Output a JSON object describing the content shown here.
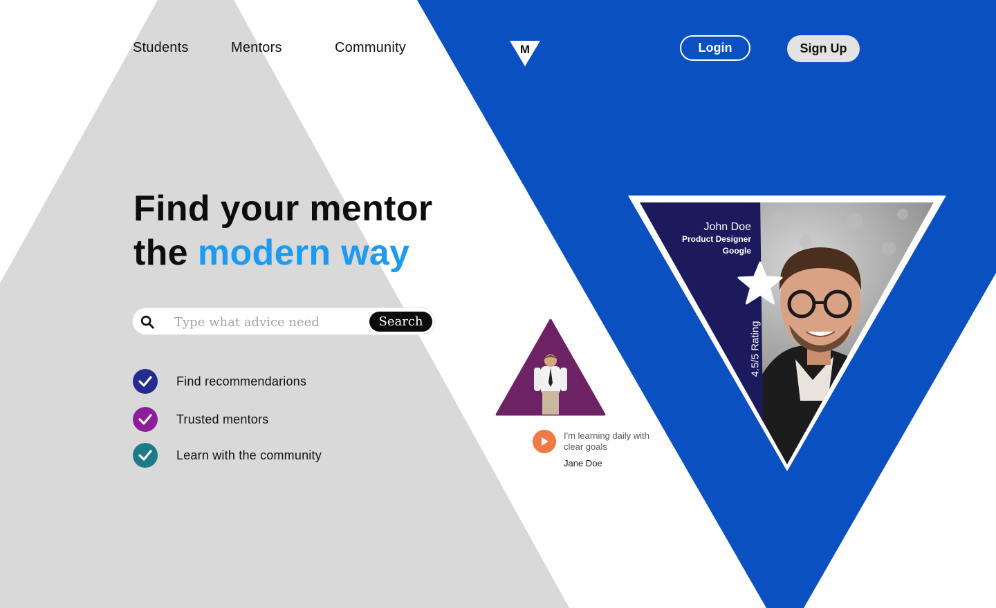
{
  "nav": {
    "links": [
      "Students",
      "Mentors",
      "Community"
    ],
    "logo_letter": "M",
    "login_label": "Login",
    "signup_label": "Sign Up"
  },
  "hero": {
    "title_line1": "Find your mentor",
    "title_line2_prefix": "the",
    "title_line2_accent": "modern way"
  },
  "search": {
    "placeholder": "Type what advice need",
    "button_label": "Search"
  },
  "features": [
    {
      "label": "Find recommendarions",
      "color": "#262b8e"
    },
    {
      "label": "Trusted mentors",
      "color": "#8b1f9a"
    },
    {
      "label": "Learn with the community",
      "color": "#1e7a88"
    }
  ],
  "testimonial": {
    "quote": "I'm learning daily with clear goals",
    "author": "Jane Doe"
  },
  "mentor": {
    "name": "John Doe",
    "role": "Product Designer",
    "company": "Google",
    "rating": "4.5/5 Rating"
  },
  "colors": {
    "blue": "#0a50c1",
    "gray": "#d9d9d9",
    "accent": "#1d9bf0",
    "navy_panel": "#1b1a5c",
    "purple": "#6d2266",
    "play": "#f07a46"
  }
}
